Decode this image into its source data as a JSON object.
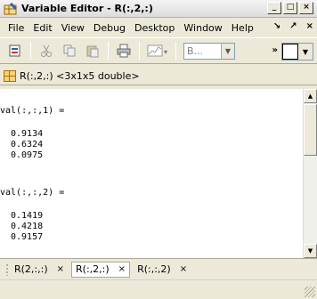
{
  "window": {
    "title": "Variable Editor - R(:,2,:)"
  },
  "menu": [
    "File",
    "Edit",
    "View",
    "Debug",
    "Desktop",
    "Window",
    "Help"
  ],
  "menu_right": {
    "undock": "↘",
    "dock": "↗",
    "close": "×"
  },
  "toolbar": {
    "combo_text": "B...",
    "overflow": "»"
  },
  "header": {
    "label": "R(:,2,:) <3x1x5 double>"
  },
  "content": {
    "slice1_title": "val(:,:,1) =",
    "slice1_values": [
      "0.9134",
      "0.6324",
      "0.0975"
    ],
    "slice2_title": "val(:,:,2) =",
    "slice2_values": [
      "0.1419",
      "0.4218",
      "0.9157"
    ]
  },
  "tabs": [
    {
      "label": "R(2,:,:)",
      "close": "×"
    },
    {
      "label": "R(:,2,:)",
      "close": "×"
    },
    {
      "label": "R(:,:,2)",
      "close": "×"
    }
  ],
  "icons": {
    "window": "variable-editor-icon",
    "toolbar": [
      "import-data-icon",
      "cut-icon",
      "copy-icon",
      "paste-icon",
      "print-icon",
      "plot-icon"
    ]
  },
  "colors": {
    "chrome": "#ece9d8",
    "grid_icon": "#f4d27a"
  }
}
